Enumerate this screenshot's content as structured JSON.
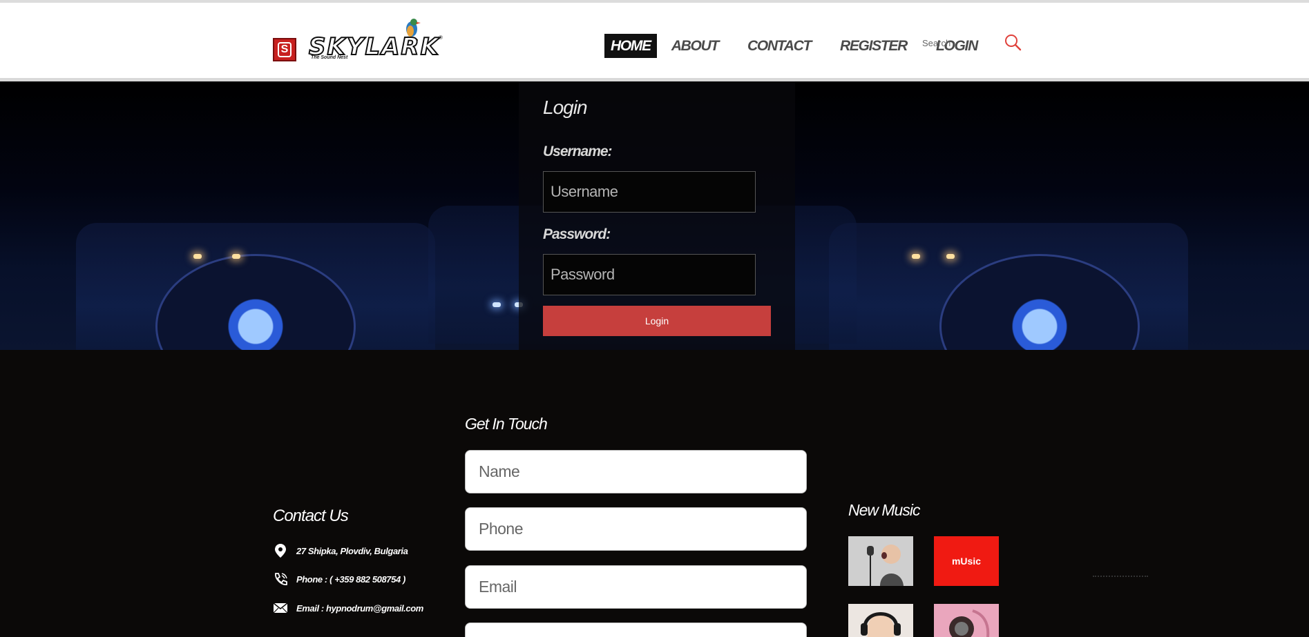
{
  "brand": {
    "badge": "S",
    "wordmark": "SKYLARK",
    "tagline": "The Sound Nest",
    "registered": "®"
  },
  "nav": {
    "items": [
      {
        "label": "HOME",
        "active": true
      },
      {
        "label": "ABOUT",
        "active": false
      },
      {
        "label": "CONTACT",
        "active": false
      },
      {
        "label": "REGISTER",
        "active": false
      },
      {
        "label": "LOGIN",
        "active": false
      }
    ]
  },
  "search": {
    "placeholder": "Search",
    "icon": "search-icon"
  },
  "login": {
    "title": "Login",
    "username_label": "Username:",
    "username_placeholder": "Username",
    "password_label": "Password:",
    "password_placeholder": "Password",
    "submit_label": "Login"
  },
  "contact": {
    "title": "Contact Us",
    "address": "27 Shipka, Plovdiv, Bulgaria",
    "phone": "Phone : ( +359 882 508754 )",
    "email": "Email : hypnodrum@gmail.com"
  },
  "touch": {
    "title": "Get In Touch",
    "name_placeholder": "Name",
    "phone_placeholder": "Phone",
    "email_placeholder": "Email"
  },
  "new_music": {
    "title": "New Music",
    "thumb_labels": [
      "",
      "mUsic",
      "",
      ""
    ]
  },
  "colors": {
    "accent_red": "#c63f3d",
    "nav_active_bg": "#111111",
    "footer_bg": "#0b0908"
  }
}
